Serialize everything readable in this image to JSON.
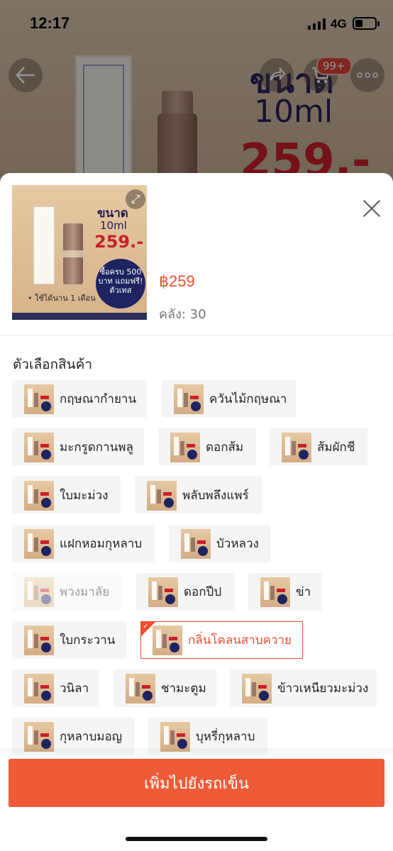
{
  "status_bar": {
    "time": "12:17",
    "network": "4G"
  },
  "hero": {
    "title_line1": "ขนาด",
    "title_line2": "10ml",
    "price_text": "259.-"
  },
  "top_bar": {
    "cart_badge": "99+"
  },
  "product": {
    "thumb": {
      "size_label": "ขนาด",
      "volume": "10ml",
      "price_text": "259.-",
      "promo": "ซื้อครบ 500 บาท แถมฟรี! ตัวเทส",
      "note": "• ใช้ได้นาน 1 เดือน"
    },
    "price": "฿259",
    "stock": "คลัง: 30"
  },
  "variants": {
    "title": "ตัวเลือกสินค้า",
    "items": [
      {
        "label": "กฤษณากำยาน",
        "state": "normal"
      },
      {
        "label": "ควันไม้กฤษณา",
        "state": "normal"
      },
      {
        "label": "มะกรูดกานพลู",
        "state": "normal"
      },
      {
        "label": "ดอกส้ม",
        "state": "normal"
      },
      {
        "label": "ส้มผักชี",
        "state": "normal"
      },
      {
        "label": "ใบมะม่วง",
        "state": "normal"
      },
      {
        "label": "พลับพลึงแพร์",
        "state": "normal"
      },
      {
        "label": "แฝกหอมกุหลาบ",
        "state": "normal"
      },
      {
        "label": "บัวหลวง",
        "state": "normal"
      },
      {
        "label": "พวงมาลัย",
        "state": "disabled"
      },
      {
        "label": "ดอกปีป",
        "state": "normal"
      },
      {
        "label": "ข่า",
        "state": "normal"
      },
      {
        "label": "ใบกระวาน",
        "state": "normal"
      },
      {
        "label": "กลิ่นโคลนสาบควาย",
        "state": "selected"
      },
      {
        "label": "วนิลา",
        "state": "normal"
      },
      {
        "label": "ชามะตูม",
        "state": "normal"
      },
      {
        "label": "ข้าวเหนียวมะม่วง",
        "state": "normal"
      },
      {
        "label": "กุหลาบมอญ",
        "state": "normal"
      },
      {
        "label": "บุหรี่กุหลาบ",
        "state": "normal"
      }
    ]
  },
  "add_to_cart": {
    "label": "เพิ่มไปยังรถเข็น"
  },
  "colors": {
    "accent": "#ee4d2d",
    "button": "#ee5b38"
  }
}
